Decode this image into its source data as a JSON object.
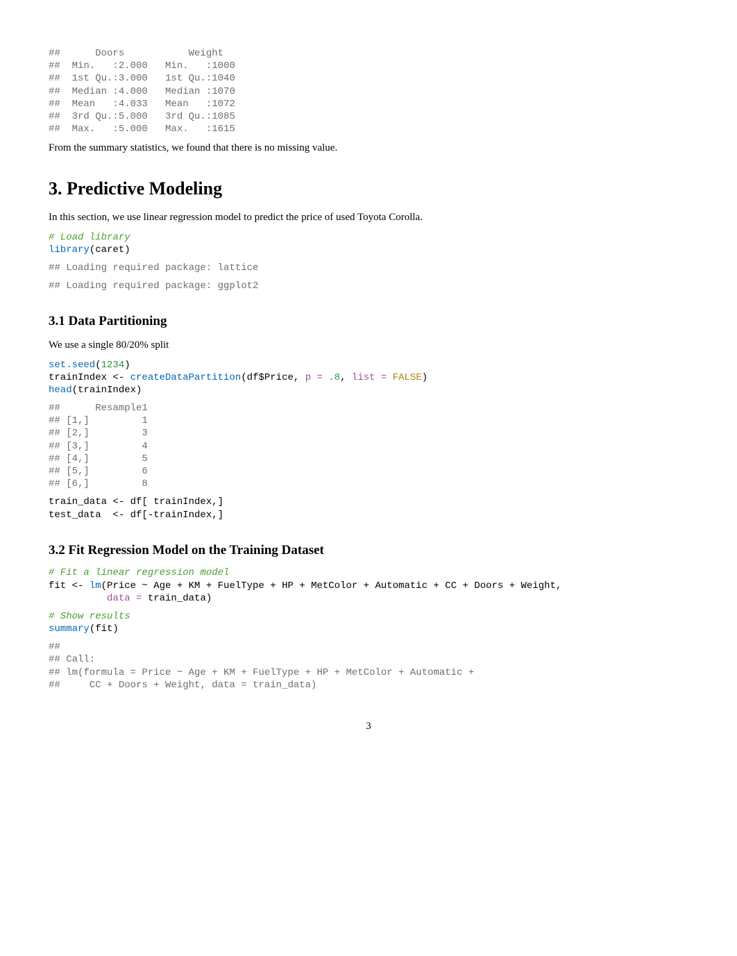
{
  "output1": "##      Doors           Weight    \n##  Min.   :2.000   Min.   :1000  \n##  1st Qu.:3.000   1st Qu.:1040  \n##  Median :4.000   Median :1070  \n##  Mean   :4.033   Mean   :1072  \n##  3rd Qu.:5.000   3rd Qu.:1085  \n##  Max.   :5.000   Max.   :1615",
  "after_summary_text": "From the summary statistics, we found that there is no missing value.",
  "h1_predictive": "3. Predictive Modeling",
  "predictive_intro": "In this section, we use linear regression model to predict the price of used Toyota Corolla.",
  "code_load_lib": {
    "comment": "# Load library",
    "func": "library",
    "arg": "(caret)"
  },
  "out_lattice": "## Loading required package: lattice",
  "out_ggplot": "## Loading required package: ggplot2",
  "h2_partition": "3.1 Data Partitioning",
  "partition_intro": "We use a single 80/20% split",
  "code_setseed": {
    "func": "set.seed",
    "open": "(",
    "num": "1234",
    "close": ")"
  },
  "code_partition": {
    "lhs": "trainIndex <- ",
    "func": "createDataPartition",
    "args_pre": "(df$Price, ",
    "p_kw": "p = ",
    "p_val": ".8",
    "sep": ", ",
    "list_kw": "list = ",
    "list_val": "FALSE",
    "close": ")"
  },
  "code_head": {
    "func": "head",
    "arg": "(trainIndex)"
  },
  "out_resample": "##      Resample1\n## [1,]         1\n## [2,]         3\n## [3,]         4\n## [4,]         5\n## [5,]         6\n## [6,]         8",
  "code_train": "train_data <- df[ trainIndex,]",
  "code_test": "test_data  <- df[-trainIndex,]",
  "h2_fit": "3.2 Fit Regression Model on the Training Dataset",
  "code_fit": {
    "comment": "# Fit a linear regression model",
    "lhs": "fit <- ",
    "func": "lm",
    "args1": "(Price ~ Age + KM + FuelType + HP + MetColor + Automatic + CC + Doors + Weight,",
    "indent": "          ",
    "data_kw": "data = ",
    "data_val": "train_data)"
  },
  "code_show": {
    "comment": "# Show results",
    "func": "summary",
    "arg": "(fit)"
  },
  "out_call": "## \n## Call:\n## lm(formula = Price ~ Age + KM + FuelType + HP + MetColor + Automatic + \n##     CC + Doors + Weight, data = train_data)",
  "pagenum": "3"
}
